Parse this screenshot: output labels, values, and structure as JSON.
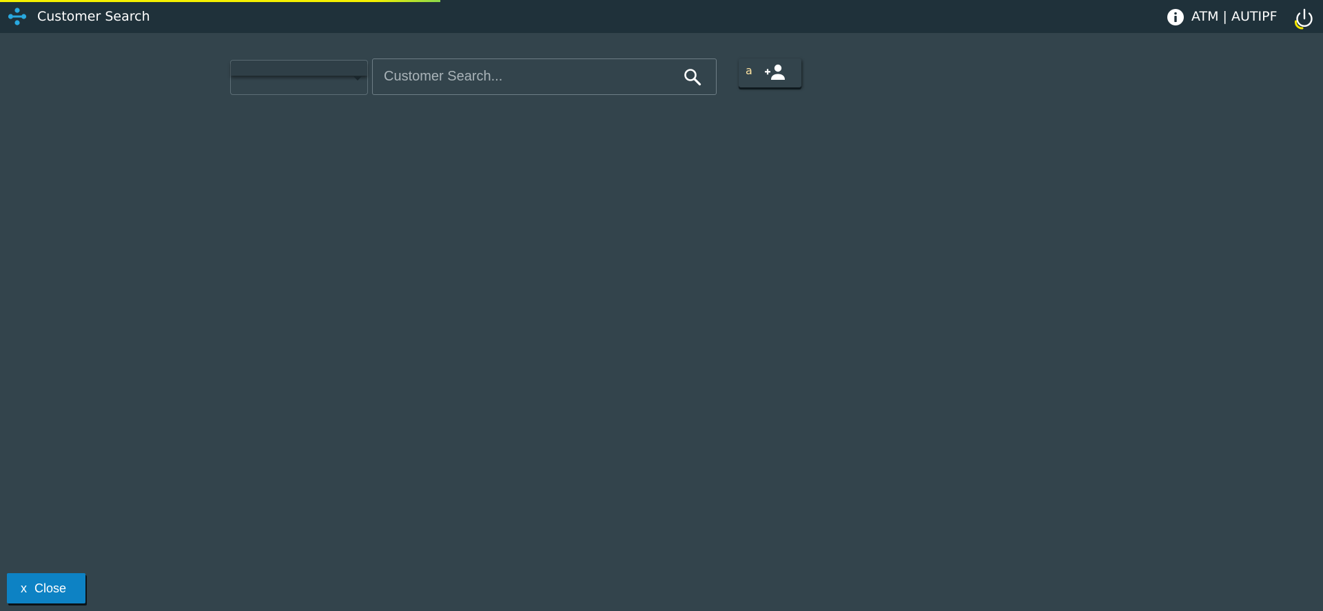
{
  "header": {
    "title": "Customer Search",
    "user": "ATM | AUTIPF",
    "loading_progress": 0.333,
    "icons": {
      "logo": "app-logo-icon",
      "info": "info-icon",
      "power": "power-icon"
    }
  },
  "search": {
    "type_select_value": "",
    "placeholder": "Customer Search...",
    "value": "",
    "add_customer_key": "a"
  },
  "footer": {
    "close_x": "x",
    "close_label": "Close"
  },
  "colors": {
    "background": "#33444c",
    "header": "#1f313a",
    "accent_blue": "#0d82c4",
    "progress": "#f4f000",
    "logo": "#29a9e0"
  }
}
